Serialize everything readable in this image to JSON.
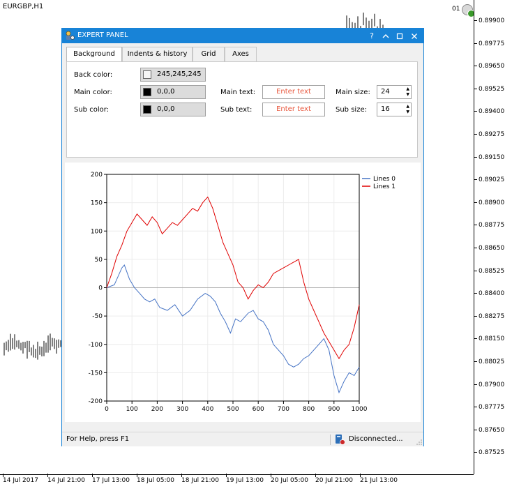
{
  "terminal": {
    "symbol": "EURGBP,H1",
    "one_click_label": "01",
    "price_ticks": [
      "0.89900",
      "0.89775",
      "0.89650",
      "0.89525",
      "0.89400",
      "0.89275",
      "0.89150",
      "0.89025",
      "0.88900",
      "0.88775",
      "0.88650",
      "0.88525",
      "0.88400",
      "0.88275",
      "0.88150",
      "0.88025",
      "0.87900",
      "0.87775",
      "0.87650",
      "0.87525"
    ],
    "time_ticks": [
      "14 Jul 2017",
      "14 Jul 21:00",
      "17 Jul 13:00",
      "18 Jul 05:00",
      "18 Jul 21:00",
      "19 Jul 13:00",
      "20 Jul 05:00",
      "20 Jul 21:00",
      "21 Jul 13:00"
    ]
  },
  "panel": {
    "title": "EXPERT PANEL",
    "titlebar_buttons": [
      "?",
      "^",
      "□",
      "×"
    ],
    "tabs": [
      "Background",
      "Indents & history",
      "Grid",
      "Axes"
    ],
    "active_tab": 0,
    "back_color": {
      "label": "Back color:",
      "value": "245,245,245",
      "swatch": "#f5f5f5"
    },
    "main_color": {
      "label": "Main color:",
      "value": "0,0,0",
      "swatch": "#000000"
    },
    "sub_color": {
      "label": "Sub color:",
      "value": "0,0,0",
      "swatch": "#000000"
    },
    "main_text": {
      "label": "Main text:",
      "placeholder": "Enter text"
    },
    "sub_text": {
      "label": "Sub text:",
      "placeholder": "Enter text"
    },
    "main_size": {
      "label": "Main size:",
      "value": "24"
    },
    "sub_size": {
      "label": "Sub size:",
      "value": "16"
    }
  },
  "status": {
    "help": "For Help, press F1",
    "connection": "Disconnected..."
  },
  "chart_data": {
    "type": "line",
    "title": "",
    "xlabel": "",
    "ylabel": "",
    "xlim": [
      0,
      1000
    ],
    "ylim": [
      -200,
      200
    ],
    "xticks": [
      0,
      100,
      200,
      300,
      400,
      500,
      600,
      700,
      800,
      900,
      1000
    ],
    "yticks": [
      200,
      150,
      100,
      50,
      0,
      -50,
      -100,
      -150,
      -200
    ],
    "grid": true,
    "legend": "top-right",
    "series": [
      {
        "name": "Lines 0",
        "color": "#4472c4",
        "x": [
          0,
          30,
          60,
          70,
          90,
          110,
          130,
          150,
          170,
          190,
          210,
          240,
          270,
          300,
          330,
          360,
          390,
          410,
          430,
          450,
          470,
          490,
          510,
          530,
          560,
          580,
          600,
          620,
          640,
          660,
          680,
          700,
          720,
          740,
          760,
          780,
          800,
          820,
          840,
          860,
          880,
          900,
          920,
          940,
          960,
          980,
          1000
        ],
        "y": [
          0,
          5,
          35,
          40,
          15,
          0,
          -10,
          -20,
          -25,
          -20,
          -35,
          -40,
          -30,
          -50,
          -40,
          -20,
          -10,
          -15,
          -25,
          -45,
          -60,
          -80,
          -55,
          -60,
          -45,
          -40,
          -55,
          -60,
          -75,
          -100,
          -110,
          -120,
          -135,
          -140,
          -135,
          -125,
          -120,
          -110,
          -100,
          -90,
          -110,
          -155,
          -185,
          -165,
          -150,
          -155,
          -140
        ]
      },
      {
        "name": "Lines 1",
        "color": "#e00000",
        "x": [
          0,
          20,
          40,
          60,
          80,
          100,
          120,
          140,
          160,
          180,
          200,
          220,
          240,
          260,
          280,
          300,
          320,
          340,
          360,
          380,
          400,
          420,
          440,
          460,
          480,
          500,
          520,
          540,
          560,
          580,
          600,
          620,
          640,
          660,
          680,
          700,
          720,
          740,
          760,
          780,
          800,
          820,
          840,
          860,
          880,
          900,
          920,
          940,
          960,
          980,
          1000
        ],
        "y": [
          0,
          25,
          55,
          75,
          100,
          115,
          130,
          120,
          110,
          125,
          115,
          95,
          105,
          115,
          110,
          120,
          130,
          140,
          135,
          150,
          160,
          140,
          110,
          80,
          60,
          40,
          10,
          0,
          -20,
          -5,
          5,
          0,
          10,
          25,
          30,
          35,
          40,
          45,
          50,
          10,
          -20,
          -40,
          -60,
          -80,
          -95,
          -110,
          -125,
          -110,
          -100,
          -70,
          -30
        ]
      }
    ]
  }
}
